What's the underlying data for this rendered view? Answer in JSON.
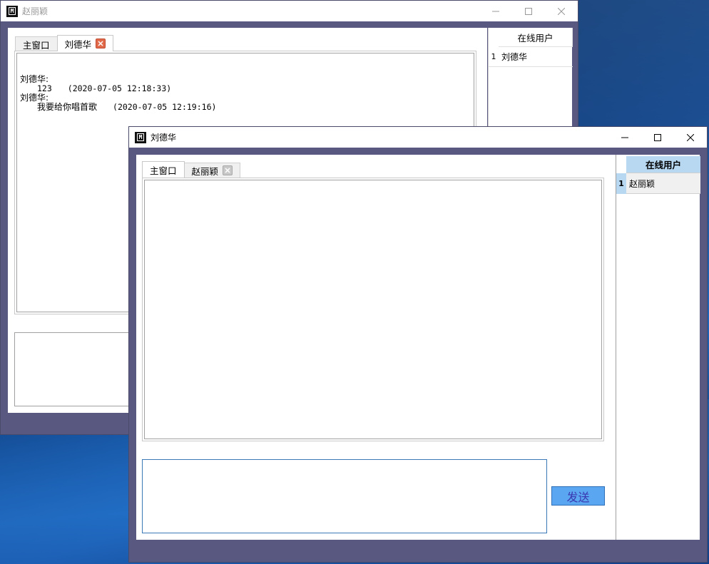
{
  "back_window": {
    "title": "赵丽颖",
    "tabs": [
      {
        "label": "主窗口",
        "active": false,
        "closable": false
      },
      {
        "label": "刘德华",
        "active": true,
        "closable": true
      }
    ],
    "messages": [
      {
        "sender": "刘德华:",
        "text": "123",
        "time": "(2020-07-05 12:18:33)"
      },
      {
        "sender": "刘德华:",
        "text": "我要给你唱首歌",
        "time": "(2020-07-05 12:19:16)"
      }
    ],
    "users_header": "在线用户",
    "users": [
      {
        "num": "1",
        "name": "刘德华"
      }
    ]
  },
  "front_window": {
    "title": "刘德华",
    "tabs": [
      {
        "label": "主窗口",
        "active": true,
        "closable": false
      },
      {
        "label": "赵丽颖",
        "active": false,
        "closable": true
      }
    ],
    "users_header": "在线用户",
    "users": [
      {
        "num": "1",
        "name": "赵丽颖"
      }
    ],
    "send_label": "发送",
    "message_input_value": ""
  },
  "colors": {
    "window_frame": "#585880",
    "tab_close_active": "#e06a4a",
    "tab_close_inactive": "#c8c8c8",
    "users_header_bg": "#b8d8f2",
    "send_button_bg": "#5aa6f0",
    "send_button_text": "#3a38b0",
    "input_border": "#3a78b8"
  },
  "icons": {
    "app": "app-logo-icon",
    "minimize": "minimize-icon",
    "maximize": "maximize-icon",
    "close": "close-icon",
    "tab_close": "tab-close-icon"
  }
}
